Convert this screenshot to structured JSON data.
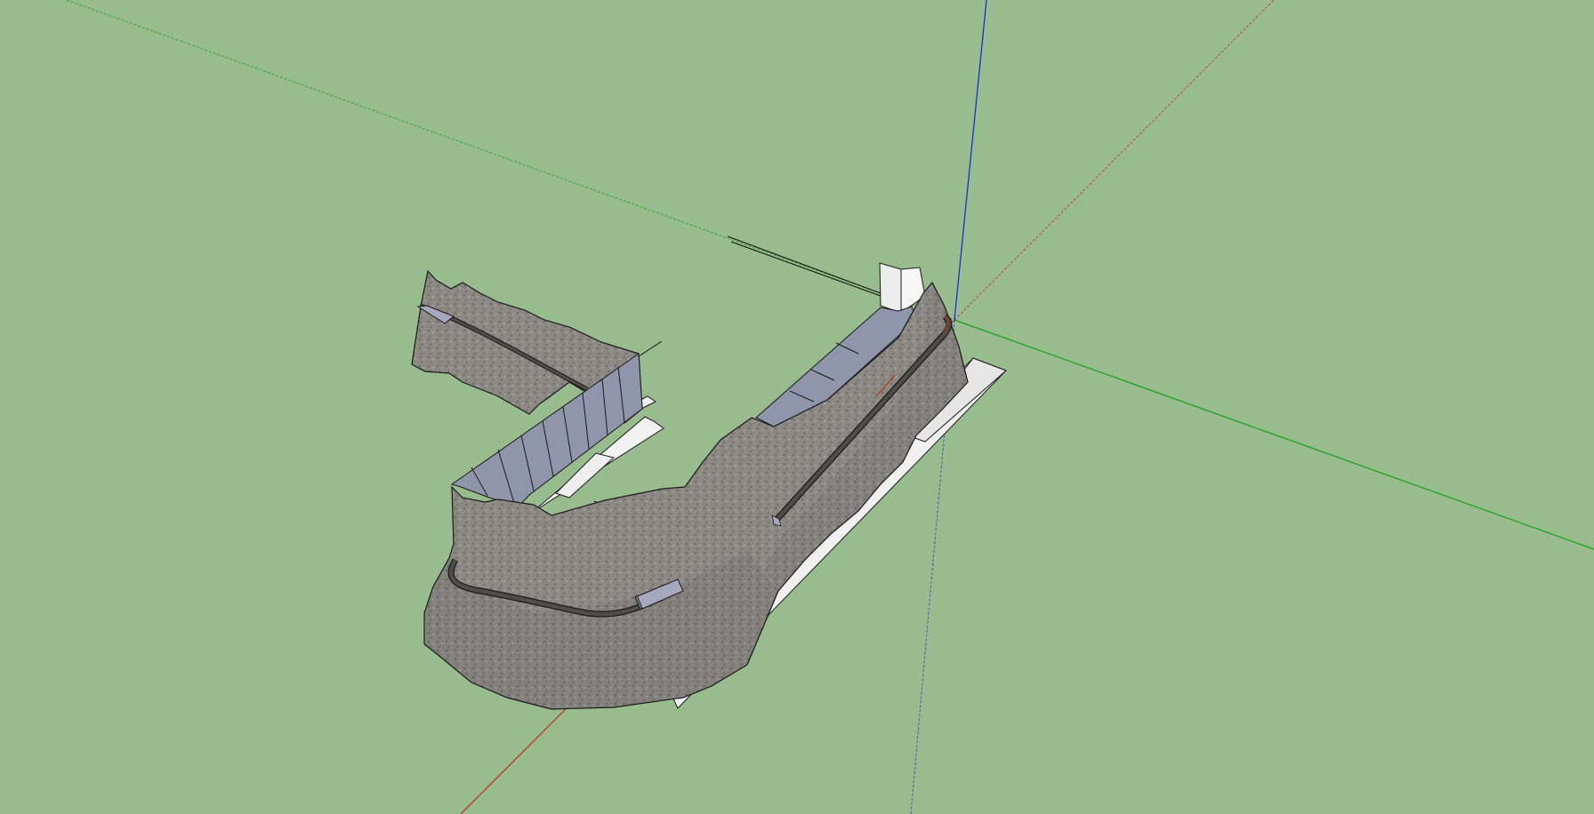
{
  "app": {
    "kind": "3D modeling viewport"
  },
  "viewport": {
    "background_color": "#99bc8e",
    "axis_colors": {
      "red": "#c0281c",
      "green": "#16a11a",
      "blue": "#1533c8"
    },
    "terrain_color": "#8d8a86",
    "wall_color": "#8f95ab",
    "base_color": "#f0f0f0",
    "track_color": "#4f4d48"
  }
}
